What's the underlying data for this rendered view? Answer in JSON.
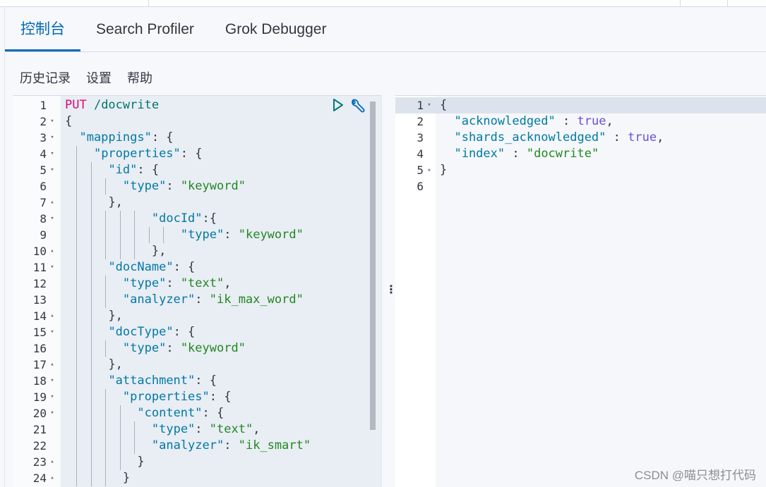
{
  "tabs": [
    {
      "label": "控制台",
      "active": true
    },
    {
      "label": "Search Profiler"
    },
    {
      "label": "Grok Debugger"
    }
  ],
  "menu": [
    "历史记录",
    "设置",
    "帮助"
  ],
  "request": {
    "lines": [
      {
        "n": "1",
        "fold": "",
        "indent": 0,
        "tokens": [
          [
            "method",
            "PUT"
          ],
          [
            "url",
            " /docwrite"
          ]
        ]
      },
      {
        "n": "2",
        "fold": "down",
        "indent": 0,
        "tokens": [
          [
            "p",
            "{"
          ]
        ]
      },
      {
        "n": "3",
        "fold": "down",
        "indent": 2,
        "tokens": [
          [
            "key",
            "\"mappings\""
          ],
          [
            "p",
            ": {"
          ]
        ]
      },
      {
        "n": "4",
        "fold": "down",
        "indent": 4,
        "tokens": [
          [
            "key",
            "\"properties\""
          ],
          [
            "p",
            ": {"
          ]
        ]
      },
      {
        "n": "5",
        "fold": "down",
        "indent": 6,
        "tokens": [
          [
            "key",
            "\"id\""
          ],
          [
            "p",
            ": {"
          ]
        ]
      },
      {
        "n": "6",
        "fold": "",
        "indent": 8,
        "tokens": [
          [
            "key",
            "\"type\""
          ],
          [
            "p",
            ": "
          ],
          [
            "str",
            "\"keyword\""
          ]
        ]
      },
      {
        "n": "7",
        "fold": "up",
        "indent": 6,
        "tokens": [
          [
            "p",
            "},"
          ]
        ]
      },
      {
        "n": "8",
        "fold": "down",
        "indent": 12,
        "tokens": [
          [
            "key",
            "\"docId\""
          ],
          [
            "p",
            ":{"
          ]
        ]
      },
      {
        "n": "9",
        "fold": "",
        "indent": 16,
        "tokens": [
          [
            "key",
            "\"type\""
          ],
          [
            "p",
            ": "
          ],
          [
            "str",
            "\"keyword\""
          ]
        ]
      },
      {
        "n": "10",
        "fold": "up",
        "indent": 12,
        "tokens": [
          [
            "p",
            "},"
          ]
        ]
      },
      {
        "n": "11",
        "fold": "down",
        "indent": 6,
        "tokens": [
          [
            "key",
            "\"docName\""
          ],
          [
            "p",
            ": {"
          ]
        ]
      },
      {
        "n": "12",
        "fold": "",
        "indent": 8,
        "tokens": [
          [
            "key",
            "\"type\""
          ],
          [
            "p",
            ": "
          ],
          [
            "str",
            "\"text\""
          ],
          [
            "p",
            ","
          ]
        ]
      },
      {
        "n": "13",
        "fold": "",
        "indent": 8,
        "tokens": [
          [
            "key",
            "\"analyzer\""
          ],
          [
            "p",
            ": "
          ],
          [
            "str",
            "\"ik_max_word\""
          ]
        ]
      },
      {
        "n": "14",
        "fold": "up",
        "indent": 6,
        "tokens": [
          [
            "p",
            "},"
          ]
        ]
      },
      {
        "n": "15",
        "fold": "down",
        "indent": 6,
        "tokens": [
          [
            "key",
            "\"docType\""
          ],
          [
            "p",
            ": {"
          ]
        ]
      },
      {
        "n": "16",
        "fold": "",
        "indent": 8,
        "tokens": [
          [
            "key",
            "\"type\""
          ],
          [
            "p",
            ": "
          ],
          [
            "str",
            "\"keyword\""
          ]
        ]
      },
      {
        "n": "17",
        "fold": "up",
        "indent": 6,
        "tokens": [
          [
            "p",
            "},"
          ]
        ]
      },
      {
        "n": "18",
        "fold": "down",
        "indent": 6,
        "tokens": [
          [
            "key",
            "\"attachment\""
          ],
          [
            "p",
            ": {"
          ]
        ]
      },
      {
        "n": "19",
        "fold": "down",
        "indent": 8,
        "tokens": [
          [
            "key",
            "\"properties\""
          ],
          [
            "p",
            ": {"
          ]
        ]
      },
      {
        "n": "20",
        "fold": "down",
        "indent": 10,
        "tokens": [
          [
            "key",
            "\"content\""
          ],
          [
            "p",
            ": {"
          ]
        ]
      },
      {
        "n": "21",
        "fold": "",
        "indent": 12,
        "tokens": [
          [
            "key",
            "\"type\""
          ],
          [
            "p",
            ": "
          ],
          [
            "str",
            "\"text\""
          ],
          [
            "p",
            ","
          ]
        ]
      },
      {
        "n": "22",
        "fold": "",
        "indent": 12,
        "tokens": [
          [
            "key",
            "\"analyzer\""
          ],
          [
            "p",
            ": "
          ],
          [
            "str",
            "\"ik_smart\""
          ]
        ]
      },
      {
        "n": "23",
        "fold": "up",
        "indent": 10,
        "tokens": [
          [
            "p",
            "}"
          ]
        ]
      },
      {
        "n": "24",
        "fold": "up",
        "indent": 8,
        "tokens": [
          [
            "p",
            "}"
          ]
        ]
      }
    ]
  },
  "response": {
    "lines": [
      {
        "n": "1",
        "fold": "down",
        "indent": 0,
        "tokens": [
          [
            "p",
            "{"
          ]
        ]
      },
      {
        "n": "2",
        "fold": "",
        "indent": 2,
        "tokens": [
          [
            "key",
            "\"acknowledged\""
          ],
          [
            "p",
            " : "
          ],
          [
            "bool",
            "true"
          ],
          [
            "p",
            ","
          ]
        ]
      },
      {
        "n": "3",
        "fold": "",
        "indent": 2,
        "tokens": [
          [
            "key",
            "\"shards_acknowledged\""
          ],
          [
            "p",
            " : "
          ],
          [
            "bool",
            "true"
          ],
          [
            "p",
            ","
          ]
        ]
      },
      {
        "n": "4",
        "fold": "",
        "indent": 2,
        "tokens": [
          [
            "key",
            "\"index\""
          ],
          [
            "p",
            " : "
          ],
          [
            "str",
            "\"docwrite\""
          ]
        ]
      },
      {
        "n": "5",
        "fold": "up",
        "indent": 0,
        "tokens": [
          [
            "p",
            "}"
          ]
        ]
      },
      {
        "n": "6",
        "fold": "",
        "indent": 0,
        "tokens": []
      }
    ]
  },
  "icons": {
    "run": "play-icon",
    "settings": "wrench-icon",
    "fold_down": "▾",
    "fold_up": "▴",
    "divider": "⋮"
  },
  "watermark": "CSDN @喵只想打代码",
  "colors": {
    "accent": "#006bb4",
    "method": "#dd0a73",
    "key": "#0079a5",
    "string": "#228822",
    "bool": "#6b4fd8"
  }
}
